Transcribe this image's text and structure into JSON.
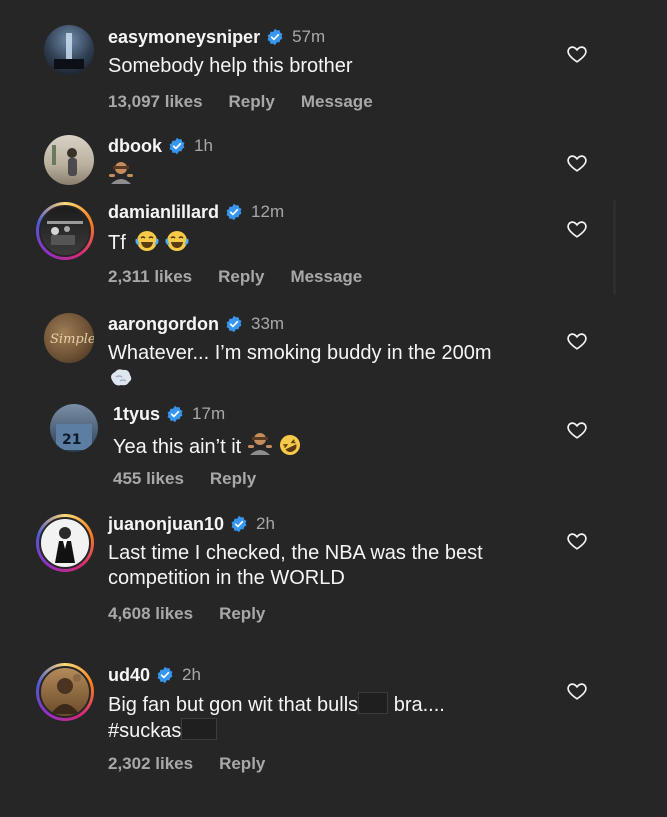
{
  "comments": [
    {
      "username": "easymoneysniper",
      "time": "57m",
      "text": "Somebody help this brother",
      "likes": "13,097 likes",
      "reply": "Reply",
      "message": "Message"
    },
    {
      "username": "dbook",
      "time": "1h"
    },
    {
      "username": "damianlillard",
      "time": "12m",
      "text": "Tf",
      "likes": "2,311 likes",
      "reply": "Reply",
      "message": "Message"
    },
    {
      "username": "aarongordon",
      "time": "33m",
      "text": "Whatever... I’m smoking buddy in the 200m"
    },
    {
      "username": "1tyus",
      "time": "17m",
      "text": "Yea this ain’t it",
      "likes": "455 likes",
      "reply": "Reply"
    },
    {
      "username": "juanonjuan10",
      "time": "2h",
      "text_line1": "Last time I checked, the NBA was the best",
      "text_line2": "competition in the WORLD",
      "likes": "4,608 likes",
      "reply": "Reply"
    },
    {
      "username": "ud40",
      "time": "2h",
      "text_part1": "Big fan but gon wit that bulls",
      "text_part2": " bra....",
      "text_line2": "#suckas",
      "likes": "2,302 likes",
      "reply": "Reply"
    }
  ],
  "icons": {
    "verified": "verified-badge-icon",
    "like": "heart-outline-icon"
  },
  "colors": {
    "background": "#262626",
    "verified": "#3797f0",
    "secondary_text": "#a8a8a8"
  }
}
